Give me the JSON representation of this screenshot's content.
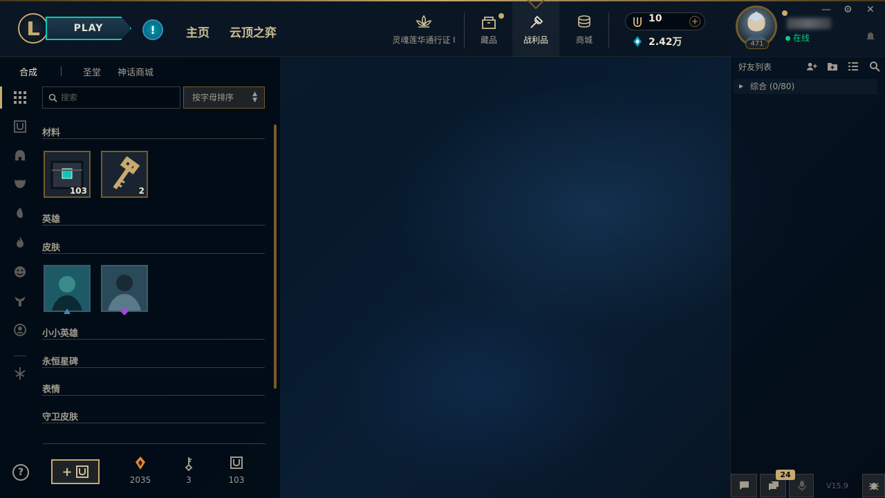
{
  "header": {
    "play_label": "PLAY",
    "alert_icon": "!",
    "nav": [
      {
        "label": "主页"
      },
      {
        "label": "云顶之弈"
      }
    ],
    "top": [
      {
        "label": "灵魂莲华通行证 I",
        "icon": "lotus-icon"
      },
      {
        "label": "藏品",
        "icon": "chest-icon"
      },
      {
        "label": "战利品",
        "icon": "loot-icon"
      },
      {
        "label": "商城",
        "icon": "store-coins-icon"
      }
    ],
    "rp": "10",
    "be": "2.42万"
  },
  "profile": {
    "level": "471",
    "status": "在线",
    "window": {
      "minimize": "—",
      "settings": "⚙",
      "close": "✕"
    }
  },
  "loot": {
    "tabs": [
      "合成",
      "圣堂",
      "神话商城"
    ],
    "search_placeholder": "搜索",
    "sort_label": "按字母排序",
    "sections": {
      "materials": "材料",
      "champions": "英雄",
      "skins": "皮肤",
      "tft": "小小英雄",
      "eternals": "永恒星碑",
      "emotes": "表情",
      "ward": "守卫皮肤"
    },
    "materials": [
      {
        "name": "hextech-chest",
        "count": "103"
      },
      {
        "name": "hextech-key",
        "count": "2"
      }
    ],
    "resources": [
      {
        "icon": "orange-essence-icon",
        "value": "2035"
      },
      {
        "icon": "key-fragment-icon",
        "value": "3"
      },
      {
        "icon": "chest-icon",
        "value": "103"
      }
    ],
    "help": "?"
  },
  "friends": {
    "title": "好友列表",
    "group": "综合 (0/80)",
    "chat_count": "24",
    "version": "V15.9"
  },
  "colors": {
    "gold": "#c8aa6e",
    "teal": "#0ac8b9",
    "online": "#0acf83"
  }
}
